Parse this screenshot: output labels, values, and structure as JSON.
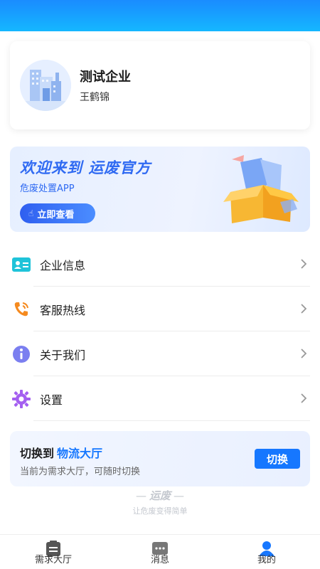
{
  "profile": {
    "company_name": "测试企业",
    "user_name": "王鹤锦"
  },
  "banner": {
    "title_prefix": "欢迎来到",
    "title_brand": "运废官方",
    "subtitle": "危废处置APP",
    "button_label": "立即查看"
  },
  "menu": {
    "items": [
      {
        "label": "企业信息",
        "icon": "id-card-icon"
      },
      {
        "label": "客服热线",
        "icon": "phone-icon"
      },
      {
        "label": "关于我们",
        "icon": "info-icon"
      },
      {
        "label": "设置",
        "icon": "gear-icon"
      }
    ]
  },
  "switch": {
    "title_prefix": "切换到",
    "title_target": "物流大厅",
    "subtitle": "当前为需求大厅，可随时切换",
    "button_label": "切换"
  },
  "footer": {
    "brand": "运废",
    "slogan": "让危废变得简单"
  },
  "tabbar": {
    "tabs": [
      {
        "label": "需求大厅",
        "icon": "clipboard-icon",
        "active": false
      },
      {
        "label": "消息",
        "icon": "message-icon",
        "active": false,
        "has_badge": true
      },
      {
        "label": "我的",
        "icon": "user-icon",
        "active": true
      }
    ]
  },
  "colors": {
    "primary": "#1677ff",
    "header_gradient_start": "#1a8cff",
    "header_gradient_end": "#15b7ff",
    "badge_red": "#f0263b"
  }
}
